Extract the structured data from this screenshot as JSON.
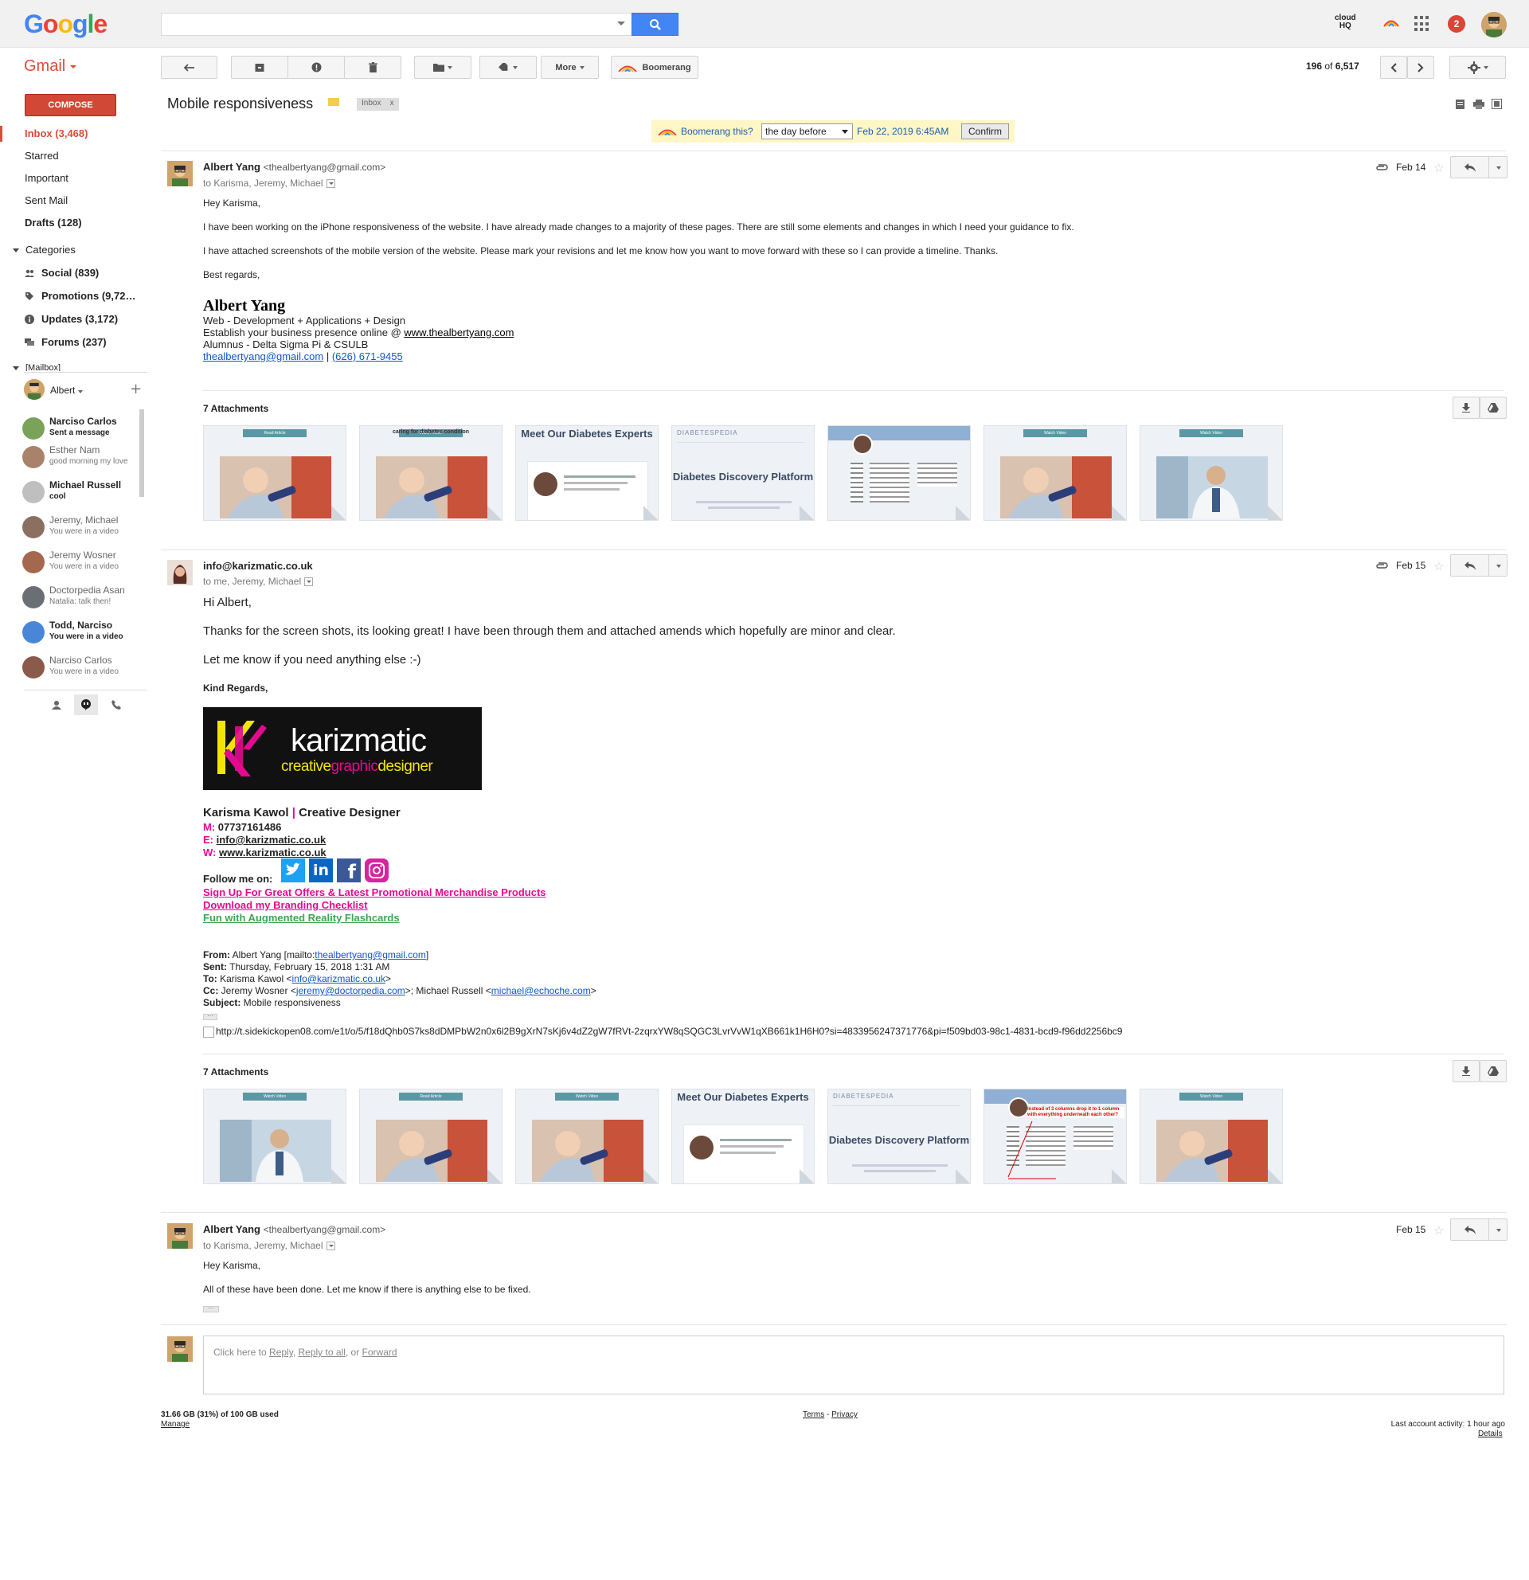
{
  "topbar": {
    "logo": [
      "G",
      "o",
      "o",
      "g",
      "l",
      "e"
    ],
    "search_placeholder": "",
    "cloudhq_line1": "cloud",
    "cloudhq_line2": "HQ",
    "notification_count": "2"
  },
  "toolbar": {
    "app_label": "Gmail",
    "more_label": "More",
    "boomerang_label": "Boomerang",
    "pager_current": "196",
    "pager_of": "of",
    "pager_total": "6,517"
  },
  "nav": {
    "compose": "COMPOSE",
    "inbox": "Inbox (3,468)",
    "starred": "Starred",
    "important": "Important",
    "sent": "Sent Mail",
    "drafts": "Drafts (128)",
    "categories_label": "Categories",
    "categories": [
      {
        "label": "Social (839)",
        "icon": "people-icon"
      },
      {
        "label": "Promotions (9,72…",
        "icon": "tag-icon"
      },
      {
        "label": "Updates (3,172)",
        "icon": "info-icon"
      },
      {
        "label": "Forums (237)",
        "icon": "forum-icon"
      }
    ],
    "mailbox_label": "[Mailbox]",
    "hangouts_user": "Albert"
  },
  "chats": [
    {
      "name": "Narciso Carlos",
      "sub": "Sent a message",
      "bold": true
    },
    {
      "name": "Esther Nam",
      "sub": "good morning my love",
      "bold": false
    },
    {
      "name": "Michael Russell",
      "sub": "cool",
      "bold": true
    },
    {
      "name": "Jeremy, Michael",
      "sub": "You were in a video",
      "bold": false
    },
    {
      "name": "Jeremy Wosner",
      "sub": "You were in a video",
      "bold": false
    },
    {
      "name": "Doctorpedia Asan",
      "sub": "Natalia: talk then!",
      "bold": false
    },
    {
      "name": "Todd, Narciso",
      "sub": "You were in a video",
      "bold": true
    },
    {
      "name": "Narciso Carlos",
      "sub": "You were in a video",
      "bold": false
    }
  ],
  "thread": {
    "subject": "Mobile responsiveness",
    "inbox_chip": "Inbox",
    "inbox_chip_x": "x",
    "boomerang": {
      "question": "Boomerang this?",
      "select_value": "the day before",
      "datetime": "Feb 22, 2019 6:45AM",
      "confirm": "Confirm"
    }
  },
  "msg1": {
    "sender": "Albert Yang",
    "email": "<thealbertyang@gmail.com>",
    "to": "to Karisma, Jeremy, Michael",
    "date": "Feb 14",
    "greeting": "Hey Karisma,",
    "p1": "I have been working on the iPhone responsiveness of the website. I have already made changes to a majority of these pages. There are still some elements and changes in which I need your guidance to fix.",
    "p2": "I have attached screenshots of the mobile version of the website. Please mark your revisions and let me know how you want to move forward with these so I can provide a timeline. Thanks.",
    "closing": "Best regards,",
    "sig_name": "Albert Yang",
    "sig_line1": "Web - Development + Applications + Design",
    "sig_line2_pre": "Establish your business presence online @ ",
    "sig_line2_link": "www.thealbertyang.com",
    "sig_line3": "Alumnus - Delta Sigma Pi & CSULB",
    "sig_email": "thealbertyang@gmail.com",
    "sig_sep": " | ",
    "sig_phone": "(626) 671-9455",
    "attachments_title": "7 Attachments"
  },
  "attachments1": [
    {
      "kind": "photo",
      "bar": "Read Article",
      "caption": ""
    },
    {
      "kind": "photo",
      "bar": "Watch Video",
      "caption": "caring for diabetes condition"
    },
    {
      "kind": "experts",
      "bar": "",
      "caption": "Meet Our Diabetes Experts"
    },
    {
      "kind": "platform",
      "bar": "",
      "caption": "Diabetes Discovery Platform"
    },
    {
      "kind": "profile",
      "bar": "",
      "caption": ""
    },
    {
      "kind": "photo",
      "bar": "Watch Video",
      "caption": ""
    },
    {
      "kind": "doctor",
      "bar": "Watch Video",
      "caption": ""
    }
  ],
  "msg2": {
    "sender": "info@karizmatic.co.uk",
    "to": "to me, Jeremy, Michael",
    "date": "Feb 15",
    "greeting": "Hi Albert,",
    "p1": "Thanks for the screen shots, its looking great!  I have been through them and attached amends which hopefully are minor and clear.",
    "p2": "Let me know if you need anything else :-)",
    "closing": "Kind Regards,",
    "logo_word": "karizmatic",
    "logo_tag_a": "creative",
    "logo_tag_b": "graphic",
    "logo_tag_c": "designer",
    "sig_name": "Karisma Kawol",
    "sig_sep": " | ",
    "sig_title": "Creative Designer",
    "m_label": "M:",
    "m_value": "07737161486",
    "e_label": "E:",
    "e_value": "info@karizmatic.co.uk",
    "w_label": "W:",
    "w_value": "www.karizmatic.co.uk",
    "follow": "Follow me on:",
    "link1": "Sign Up For Great Offers & Latest Promotional Merchandise Products",
    "link2": "Download my Branding Checklist",
    "link3": "Fun with Augmented Reality Flashcards",
    "from_label": "From:",
    "from_value": " Albert Yang [mailto:",
    "from_link": "thealbertyang@gmail.com",
    "from_end": "]",
    "sent_label": "Sent:",
    "sent_value": " Thursday, February 15, 2018 1:31 AM",
    "to_label": "To:",
    "to_value": " Karisma Kawol <",
    "to_link": "info@karizmatic.co.uk",
    "to_end": ">",
    "cc_label": "Cc:",
    "cc_value": " Jeremy Wosner <",
    "cc_link1": "jeremy@doctorpedia.com",
    "cc_mid": ">; Michael Russell <",
    "cc_link2": "michael@echoche.com",
    "cc_end": ">",
    "subject_label": "Subject:",
    "subject_value": " Mobile responsiveness",
    "tracking": "http://t.sidekickopen08.com/e1t/o/5/f18dQhb0S7ks8dDMPbW2n0x6l2B9gXrN7sKj6v4dZ2gW7fRVt-2zqrxYW8qSQGC3LvrVvW1qXB661k1H6H0?si=4833956247371776&pi=f509bd03-98c1-4831-bcd9-f96dd2256bc9",
    "attachments_title": "7 Attachments"
  },
  "attachments2": [
    {
      "kind": "doctor",
      "bar": "Watch Video",
      "caption": ""
    },
    {
      "kind": "photo",
      "bar": "Read Article",
      "caption": ""
    },
    {
      "kind": "photo",
      "bar": "Watch Video",
      "caption": ""
    },
    {
      "kind": "experts",
      "bar": "",
      "caption": "Meet Our Diabetes Experts"
    },
    {
      "kind": "platform",
      "bar": "",
      "caption": "Diabetes Discovery Platform"
    },
    {
      "kind": "profile",
      "bar": "",
      "caption": "Instead of 3 columns drop it to 1 column with everything underneath each other?"
    },
    {
      "kind": "photo",
      "bar": "Watch Video",
      "caption": ""
    }
  ],
  "msg3": {
    "sender": "Albert Yang",
    "email": "<thealbertyang@gmail.com>",
    "to": "to Karisma, Jeremy, Michael",
    "date": "Feb 15",
    "greeting": "Hey Karisma,",
    "p1": "All of these have been done. Let me know if there is anything else to be fixed."
  },
  "reply": {
    "pre": "Click here to ",
    "reply": "Reply",
    "sep1": ", ",
    "reply_all": "Reply to all",
    "sep2": ", or ",
    "forward": "Forward"
  },
  "footer": {
    "storage": "31.66 GB (31%) of 100 GB used",
    "manage": "Manage",
    "terms": "Terms",
    "dash": " - ",
    "privacy": "Privacy",
    "activity": "Last account activity: 1 hour ago",
    "details": "Details"
  },
  "colors": {
    "gmail_red": "#dd4b39",
    "compose": "#d14836",
    "search_blue": "#4285f4",
    "link": "#1155cc",
    "karizmatic_magenta": "#e30a8f"
  }
}
